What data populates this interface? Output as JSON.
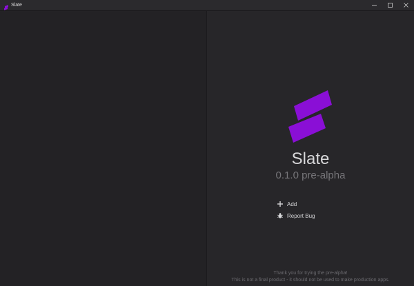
{
  "window": {
    "title": "Slate",
    "controls": {
      "minimize_icon": "minimize-icon",
      "maximize_icon": "maximize-icon",
      "close_icon": "close-icon"
    }
  },
  "welcome": {
    "app_name": "Slate",
    "version": "0.1.0 pre-alpha",
    "logo_icon": "slate-logo",
    "actions": [
      {
        "label": "Add",
        "icon": "plus-icon"
      },
      {
        "label": "Report Bug",
        "icon": "bug-icon"
      }
    ],
    "footer": {
      "line1": "Thank you for trying the pre-alpha!",
      "line2": "This is not a final product - it should not be used to make production apps."
    }
  },
  "colors": {
    "accent": "#8a0fd6",
    "background": "#262528",
    "sidebar": "#232225",
    "text_primary": "#d7d7d9",
    "text_muted": "#77767a"
  }
}
